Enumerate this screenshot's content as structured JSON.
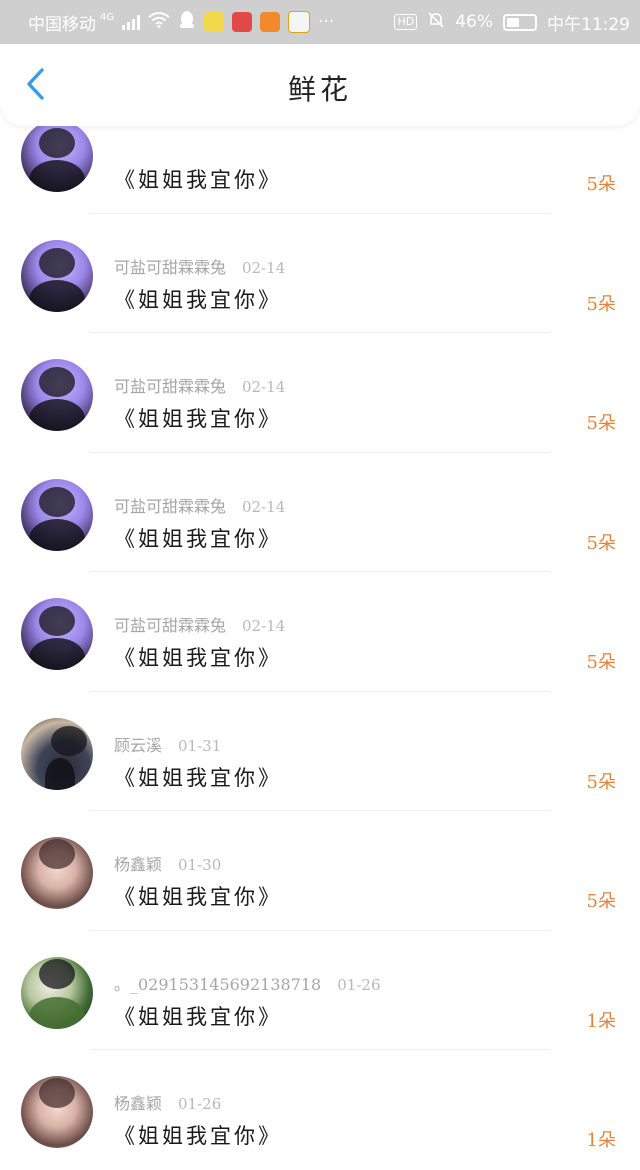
{
  "status_bar": {
    "carrier": "中国移动",
    "network": "4G",
    "battery": "46%",
    "time": "中午11:29",
    "hd": "HD",
    "colors": {
      "background": "#cfcfcf",
      "text": "#ffffff"
    }
  },
  "header": {
    "title": "鲜花",
    "back_icon": "chevron-left-icon",
    "accent_color": "#3a9be8"
  },
  "gifts": [
    {
      "avatar": "a1",
      "user": "",
      "date": "",
      "book": "《姐姐我宜你》",
      "count": "5朵"
    },
    {
      "avatar": "a1",
      "user": "可盐可甜霖霖兔",
      "date": "02-14",
      "book": "《姐姐我宜你》",
      "count": "5朵"
    },
    {
      "avatar": "a1",
      "user": "可盐可甜霖霖兔",
      "date": "02-14",
      "book": "《姐姐我宜你》",
      "count": "5朵"
    },
    {
      "avatar": "a1",
      "user": "可盐可甜霖霖兔",
      "date": "02-14",
      "book": "《姐姐我宜你》",
      "count": "5朵"
    },
    {
      "avatar": "a1",
      "user": "可盐可甜霖霖兔",
      "date": "02-14",
      "book": "《姐姐我宜你》",
      "count": "5朵"
    },
    {
      "avatar": "a2",
      "user": "顾云溪",
      "date": "01-31",
      "book": "《姐姐我宜你》",
      "count": "5朵"
    },
    {
      "avatar": "a3",
      "user": "杨鑫颖",
      "date": "01-30",
      "book": "《姐姐我宜你》",
      "count": "5朵"
    },
    {
      "avatar": "a4",
      "user": "。_029153145692138718",
      "date": "01-26",
      "book": "《姐姐我宜你》",
      "count": "1朵"
    },
    {
      "avatar": "a3",
      "user": "杨鑫颖",
      "date": "01-26",
      "book": "《姐姐我宜你》",
      "count": "1朵"
    }
  ],
  "colors": {
    "count": "#e0843e",
    "username": "#a6a6a6",
    "book_title": "#1a1a1a"
  }
}
